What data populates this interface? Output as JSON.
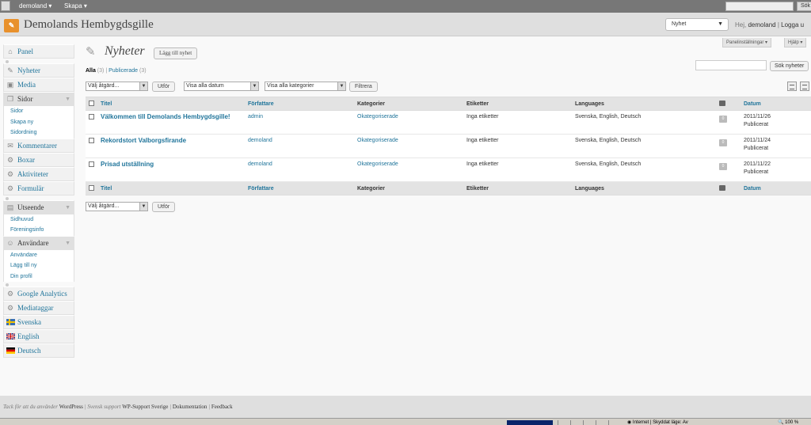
{
  "adminbar": {
    "site_menu": "demoland",
    "create_menu": "Skapa",
    "search_button": "Sök"
  },
  "header": {
    "site_title": "Demolands Hembygdsgille",
    "favorite_action": "Nyhet",
    "greeting_prefix": "Hej,",
    "user": "demoland",
    "separator": "|",
    "logout": "Logga u"
  },
  "screen_meta": {
    "panel_settings": "Panelinställningar",
    "help": "Hjälp"
  },
  "sidebar": {
    "panel": "Panel",
    "nyheter": "Nyheter",
    "media": "Media",
    "sidor": "Sidor",
    "sidor_sub": [
      "Sidor",
      "Skapa ny",
      "Sidordning"
    ],
    "kommentarer": "Kommentarer",
    "boxar": "Boxar",
    "aktiviteter": "Aktiviteter",
    "formular": "Formulär",
    "utseende": "Utseende",
    "utseende_sub": [
      "Sidhuvud",
      "Föreningsinfo"
    ],
    "anvandare": "Användare",
    "anvandare_sub": [
      "Användare",
      "Lägg till ny",
      "Din profil"
    ],
    "google_analytics": "Google Analytics",
    "mediataggar": "Mediataggar",
    "svenska": "Svenska",
    "english": "English",
    "deutsch": "Deutsch"
  },
  "main": {
    "title": "Nyheter",
    "add_new": "Lägg till nyhet",
    "filter_all": "Alla",
    "filter_all_count": "(3)",
    "filter_sep": "|",
    "filter_published": "Publicerade",
    "filter_published_count": "(3)",
    "search_button": "Sök nyheter",
    "bulk_action": "Välj åtgärd...",
    "apply": "Utför",
    "date_filter": "Visa alla datum",
    "category_filter": "Visa alla kategorier",
    "filter_button": "Filtrera"
  },
  "table": {
    "headers": {
      "title": "Titel",
      "author": "Författare",
      "categories": "Kategorier",
      "tags": "Etiketter",
      "languages": "Languages",
      "date": "Datum"
    },
    "rows": [
      {
        "title": "Välkommen till Demolands Hembygdsgille!",
        "author": "admin",
        "category": "Okategoriserade",
        "tags": "Inga etiketter",
        "languages": "Svenska, English, Deutsch",
        "comments": "0",
        "date": "2011/11/26",
        "status": "Publicerat"
      },
      {
        "title": "Rekordstort Valborgsfirande",
        "author": "demoland",
        "category": "Okategoriserade",
        "tags": "Inga etiketter",
        "languages": "Svenska, English, Deutsch",
        "comments": "0",
        "date": "2011/11/24",
        "status": "Publicerat"
      },
      {
        "title": "Prisad utställning",
        "author": "demoland",
        "category": "Okategoriserade",
        "tags": "Inga etiketter",
        "languages": "Svenska, English, Deutsch",
        "comments": "0",
        "date": "2011/11/22",
        "status": "Publicerat"
      }
    ]
  },
  "footer": {
    "thanks": "Tack för att du använder",
    "wordpress": "WordPress",
    "support_prefix": "| Svensk support",
    "support_link": "WP-Support Sverige",
    "sep": "|",
    "docs": "Dokumentation",
    "feedback": "Feedback"
  },
  "statusbar": {
    "zone": "Internet | Skyddat läge: Av",
    "zoom": "100 %"
  },
  "colors": {
    "link": "#21759b",
    "logo": "#e8912c"
  }
}
